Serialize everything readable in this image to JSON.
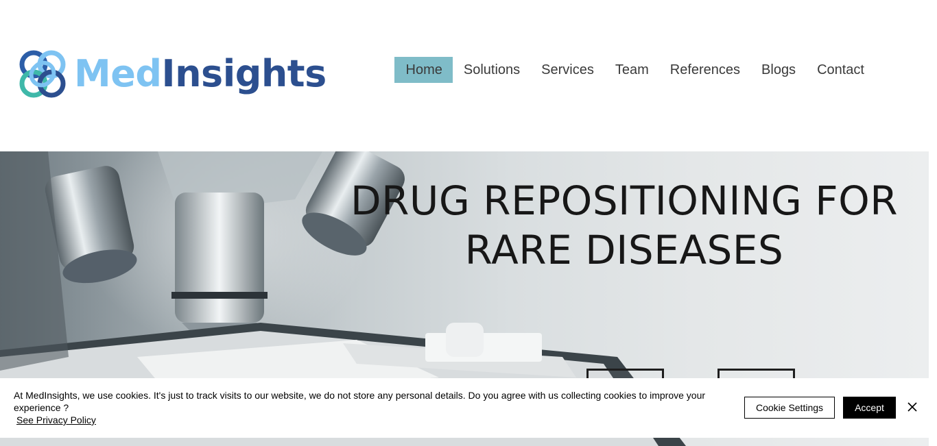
{
  "brand": {
    "name_part1": "Med",
    "name_part2": "Insights"
  },
  "nav": {
    "items": [
      {
        "label": "Home",
        "active": true
      },
      {
        "label": "Solutions"
      },
      {
        "label": "Services"
      },
      {
        "label": "Team"
      },
      {
        "label": "References"
      },
      {
        "label": "Blogs"
      },
      {
        "label": "Contact"
      }
    ]
  },
  "hero": {
    "title_line1": "DRUG REPOSITIONING FOR",
    "title_line2": "RARE DISEASES"
  },
  "cookie_banner": {
    "message": "At MedInsights, we use cookies. It's just to track visits to our website, we do not store any personal details. Do you agree with us collecting cookies to improve your experience ?",
    "privacy_link": "See Privacy Policy",
    "settings_label": "Cookie Settings",
    "accept_label": "Accept"
  },
  "colors": {
    "logo_light": "#7ec3f2",
    "logo_dark": "#2c4f8f",
    "logo_teal": "#3fb8a9",
    "nav_active_bg": "#7fbcc8"
  },
  "icons": {
    "close": "close-icon",
    "logo": "interlocking-rings-logo-icon"
  }
}
